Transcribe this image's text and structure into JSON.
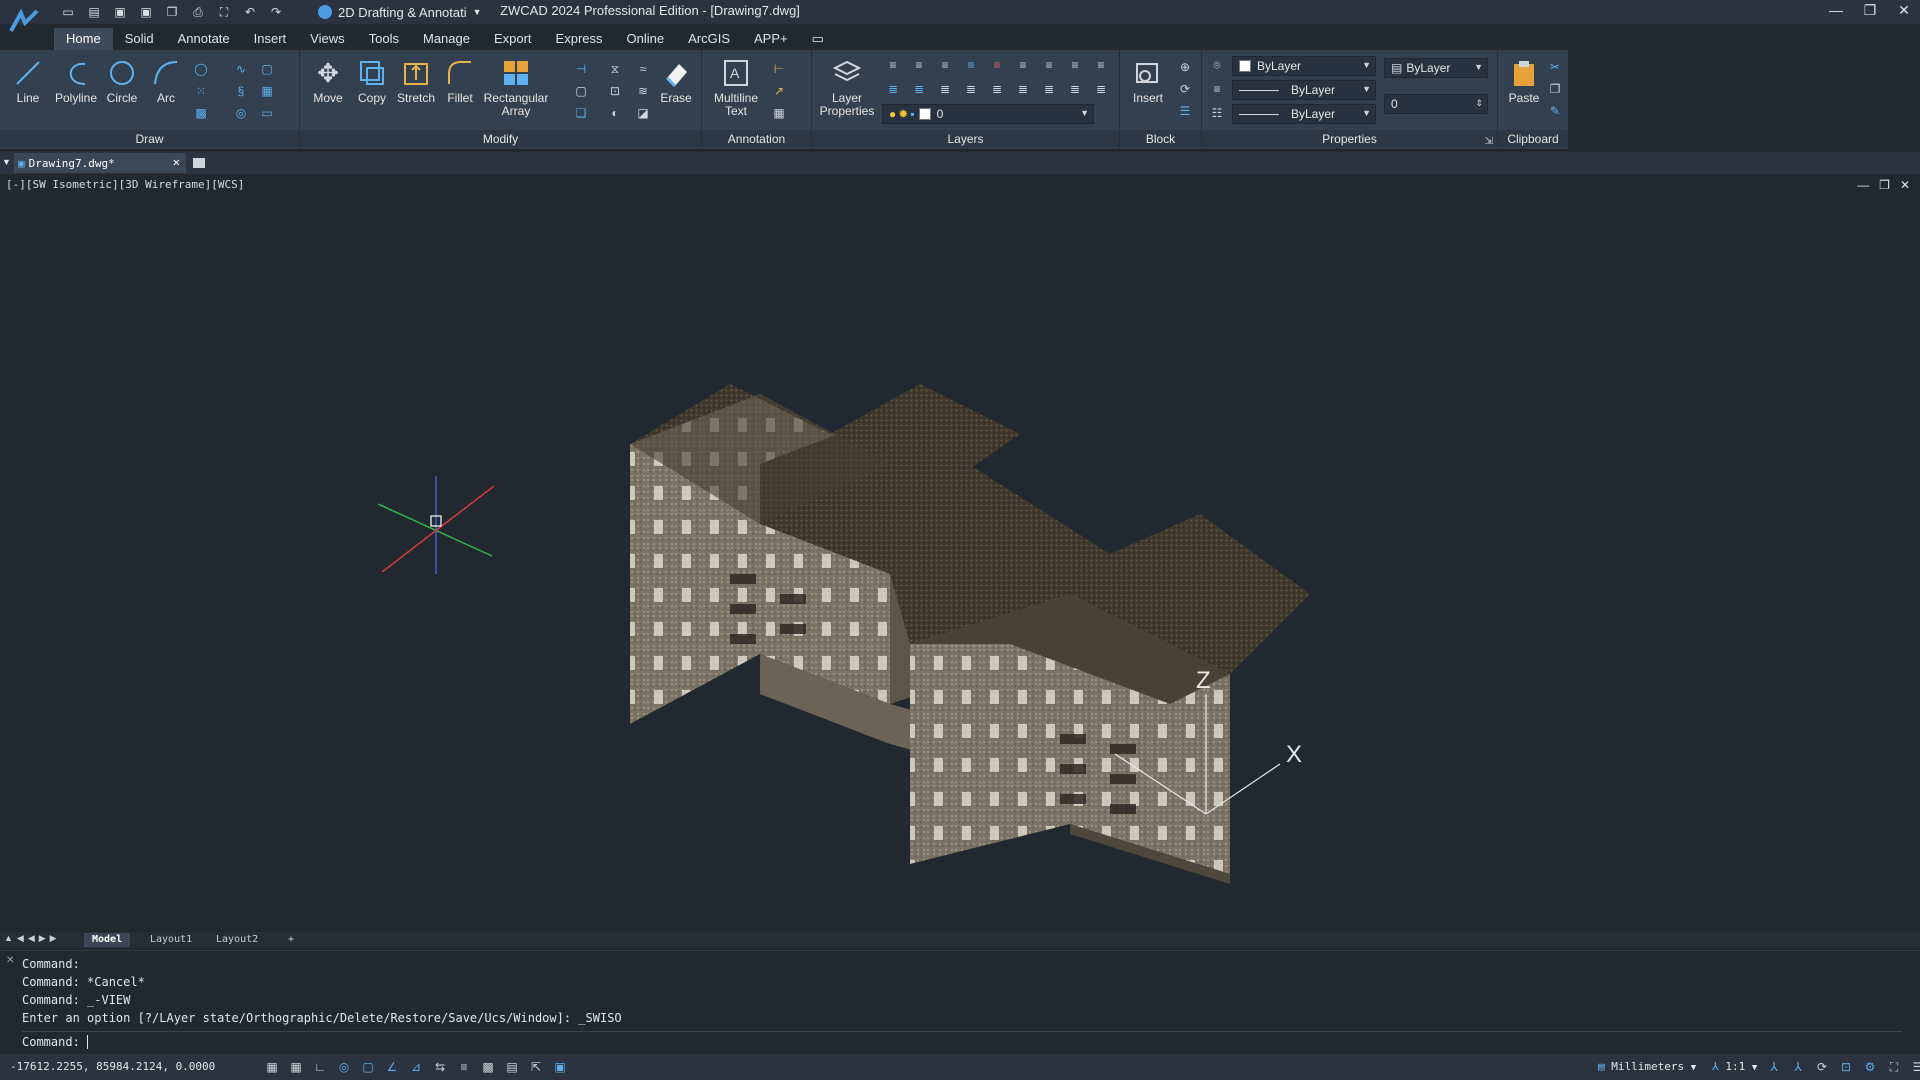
{
  "app": {
    "title": "ZWCAD 2024 Professional Edition - [Drawing7.dwg]",
    "workspace": "2D Drafting & Annotati"
  },
  "menu_tabs": [
    "Home",
    "Solid",
    "Annotate",
    "Insert",
    "Views",
    "Tools",
    "Manage",
    "Export",
    "Express",
    "Online",
    "ArcGIS",
    "APP+"
  ],
  "ribbon": {
    "draw": {
      "title": "Draw",
      "line": "Line",
      "polyline": "Polyline",
      "circle": "Circle",
      "arc": "Arc"
    },
    "modify": {
      "title": "Modify",
      "move": "Move",
      "copy": "Copy",
      "stretch": "Stretch",
      "fillet": "Fillet",
      "rect_array_1": "Rectangular",
      "rect_array_2": "Array",
      "erase": "Erase"
    },
    "annotation": {
      "title": "Annotation",
      "mtext_1": "Multiline",
      "mtext_2": "Text"
    },
    "layers": {
      "title": "Layers",
      "lp_1": "Layer",
      "lp_2": "Properties",
      "current_layer": "0"
    },
    "block": {
      "title": "Block",
      "insert": "Insert"
    },
    "properties": {
      "title": "Properties",
      "color": "ByLayer",
      "linetype": "ByLayer",
      "lineweight": "ByLayer",
      "plotstyle": "ByLayer",
      "value": "0"
    },
    "clipboard": {
      "title": "Clipboard",
      "paste": "Paste"
    }
  },
  "doc_tab": {
    "name": "Drawing7.dwg*"
  },
  "viewport": {
    "label": "[-][SW Isometric][3D Wireframe][WCS]",
    "ucs_z": "Z",
    "ucs_x": "X"
  },
  "layout_tabs": [
    "Model",
    "Layout1",
    "Layout2",
    "+"
  ],
  "command": {
    "history": [
      "Command:",
      "Command: *Cancel*",
      "Command: _-VIEW",
      "Enter an option [?/LAyer state/Orthographic/Delete/Restore/Save/Ucs/Window]: _SWISO"
    ],
    "prompt": "Command: "
  },
  "status": {
    "coords": "-17612.2255, 85984.2124, 0.0000",
    "units": "Millimeters",
    "scale": "1:1"
  },
  "colors": {
    "accent": "#4b9be0",
    "background": "#212830",
    "ribbon": "#33404f"
  }
}
